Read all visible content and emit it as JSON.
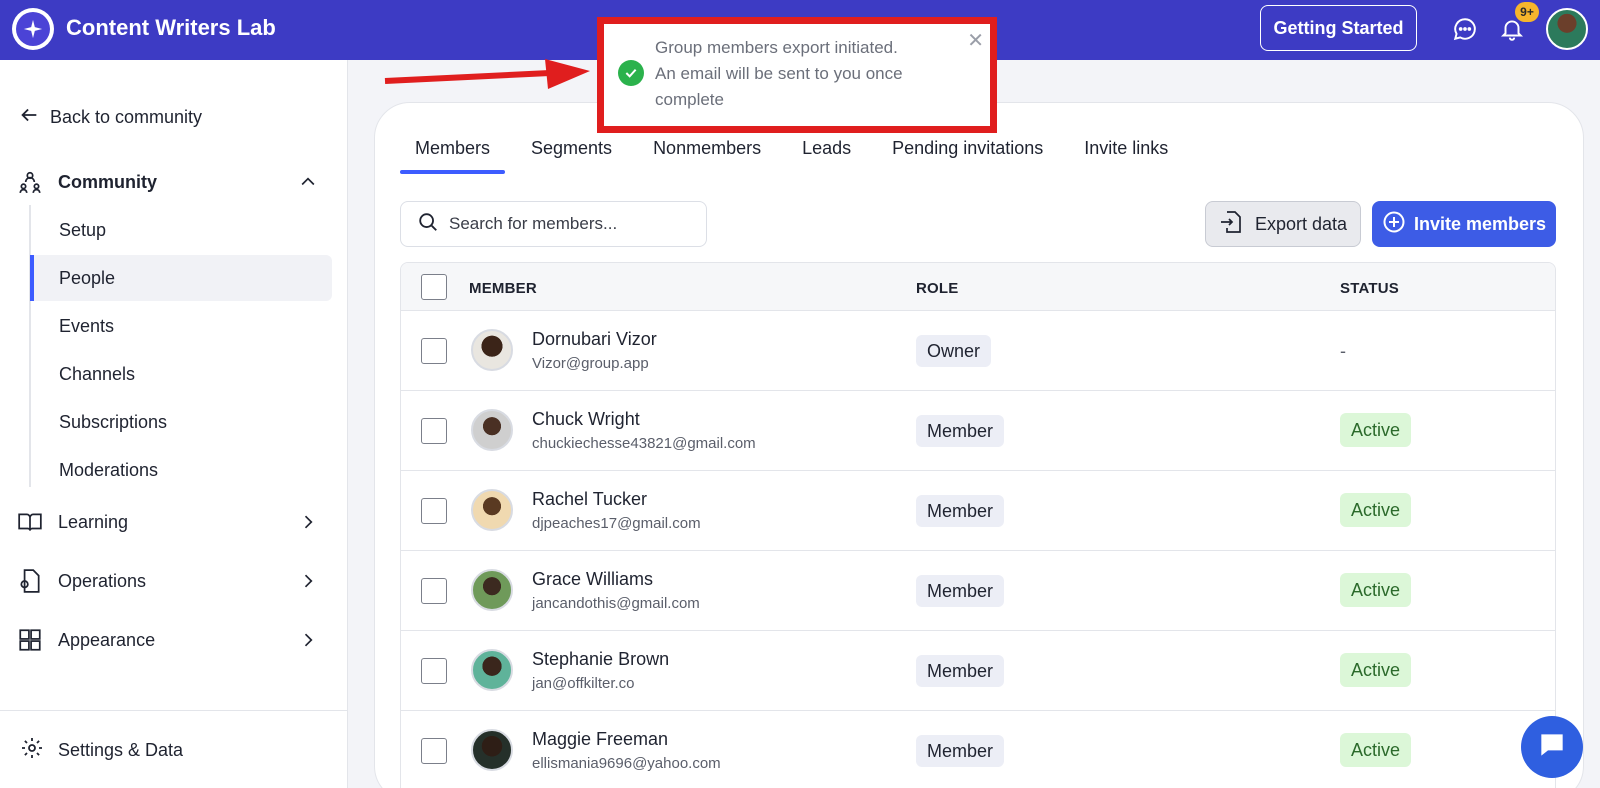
{
  "header": {
    "app_title": "Content Writers Lab",
    "getting_started_label": "Getting Started",
    "notification_badge": "9+",
    "brand_color": "#3d3bc4"
  },
  "sidebar": {
    "back_label": "Back to community",
    "community": {
      "label": "Community",
      "items": [
        {
          "label": "Setup"
        },
        {
          "label": "People"
        },
        {
          "label": "Events"
        },
        {
          "label": "Channels"
        },
        {
          "label": "Subscriptions"
        },
        {
          "label": "Moderations"
        }
      ],
      "active_item": "People"
    },
    "sections": [
      {
        "label": "Learning",
        "icon": "book-icon"
      },
      {
        "label": "Operations",
        "icon": "document-gear-icon"
      },
      {
        "label": "Appearance",
        "icon": "layout-icon"
      }
    ],
    "settings_label": "Settings & Data"
  },
  "main": {
    "tabs": [
      {
        "label": "Members"
      },
      {
        "label": "Segments"
      },
      {
        "label": "Nonmembers"
      },
      {
        "label": "Leads"
      },
      {
        "label": "Pending invitations"
      },
      {
        "label": "Invite links"
      }
    ],
    "active_tab": "Members",
    "search_placeholder": "Search for members...",
    "export_label": "Export data",
    "invite_label": "Invite members",
    "accent_color": "#3d5ce6",
    "table": {
      "columns": [
        "MEMBER",
        "ROLE",
        "STATUS"
      ],
      "rows": [
        {
          "name": "Dornubari Vizor",
          "email": "Vizor@group.app",
          "role": "Owner",
          "status": "-"
        },
        {
          "name": "Chuck Wright",
          "email": "chuckiechesse43821@gmail.com",
          "role": "Member",
          "status": "Active"
        },
        {
          "name": "Rachel Tucker",
          "email": "djpeaches17@gmail.com",
          "role": "Member",
          "status": "Active"
        },
        {
          "name": "Grace Williams",
          "email": "jancandothis@gmail.com",
          "role": "Member",
          "status": "Active"
        },
        {
          "name": "Stephanie Brown",
          "email": "jan@offkilter.co",
          "role": "Member",
          "status": "Active"
        },
        {
          "name": "Maggie Freeman",
          "email": "ellismania9696@yahoo.com",
          "role": "Member",
          "status": "Active"
        }
      ]
    }
  },
  "toast": {
    "message_line1": "Group members export initiated.",
    "message_line2": "An email will be sent to you once complete",
    "highlight_color": "#e01e1e"
  }
}
